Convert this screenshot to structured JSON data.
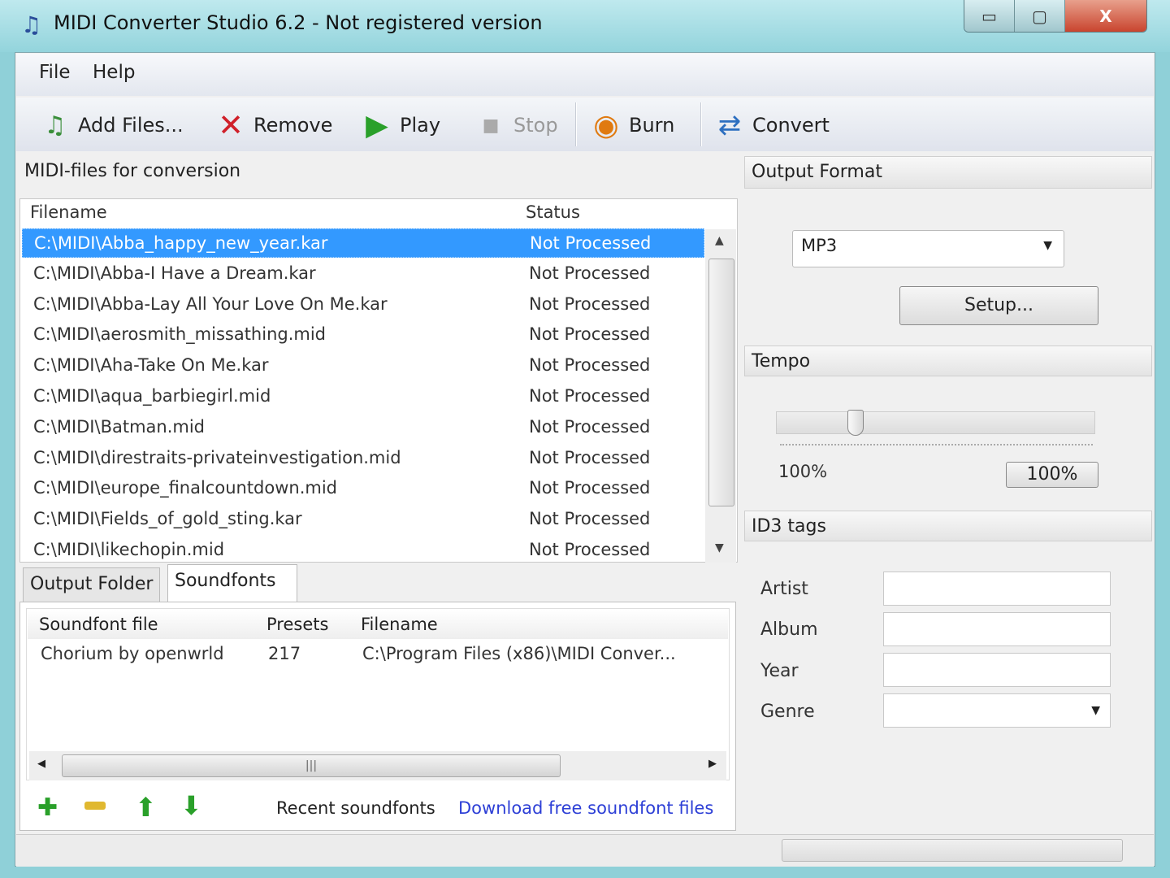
{
  "window": {
    "title": "MIDI Converter Studio 6.2 - Not registered version",
    "minimize": "▭",
    "maximize": "▢",
    "close": "X"
  },
  "menu": {
    "file": "File",
    "help": "Help"
  },
  "toolbar": {
    "add_files": "Add Files...",
    "remove": "Remove",
    "play": "Play",
    "stop": "Stop",
    "burn": "Burn",
    "convert": "Convert"
  },
  "files_panel": {
    "title": "MIDI-files for conversion",
    "col_filename": "Filename",
    "col_status": "Status",
    "rows": [
      {
        "filename": "C:\\MIDI\\Abba_happy_new_year.kar",
        "status": "Not Processed"
      },
      {
        "filename": "C:\\MIDI\\Abba-I Have a Dream.kar",
        "status": "Not Processed"
      },
      {
        "filename": "C:\\MIDI\\Abba-Lay All Your Love On Me.kar",
        "status": "Not Processed"
      },
      {
        "filename": "C:\\MIDI\\aerosmith_missathing.mid",
        "status": "Not Processed"
      },
      {
        "filename": "C:\\MIDI\\Aha-Take On Me.kar",
        "status": "Not Processed"
      },
      {
        "filename": "C:\\MIDI\\aqua_barbiegirl.mid",
        "status": "Not Processed"
      },
      {
        "filename": "C:\\MIDI\\Batman.mid",
        "status": "Not Processed"
      },
      {
        "filename": "C:\\MIDI\\direstraits-privateinvestigation.mid",
        "status": "Not Processed"
      },
      {
        "filename": "C:\\MIDI\\europe_finalcountdown.mid",
        "status": "Not Processed"
      },
      {
        "filename": "C:\\MIDI\\Fields_of_gold_sting.kar",
        "status": "Not Processed"
      },
      {
        "filename": "C:\\MIDI\\likechopin.mid",
        "status": "Not Processed"
      }
    ]
  },
  "tabs": {
    "output_folder": "Output Folder",
    "soundfonts": "Soundfonts"
  },
  "soundfonts": {
    "col_file": "Soundfont file",
    "col_presets": "Presets",
    "col_filename": "Filename",
    "rows": [
      {
        "file": "Chorium by openwrld",
        "presets": "217",
        "filename": "C:\\Program Files (x86)\\MIDI Conver..."
      }
    ],
    "recent": "Recent soundfonts",
    "download_link": "Download free soundfont files"
  },
  "output_format": {
    "title": "Output Format",
    "value": "MP3",
    "setup": "Setup..."
  },
  "tempo": {
    "title": "Tempo",
    "value_label": "100%",
    "reset_button": "100%",
    "slider_fraction": 0.25
  },
  "id3": {
    "title": "ID3 tags",
    "artist": "Artist",
    "album": "Album",
    "year": "Year",
    "genre": "Genre"
  }
}
